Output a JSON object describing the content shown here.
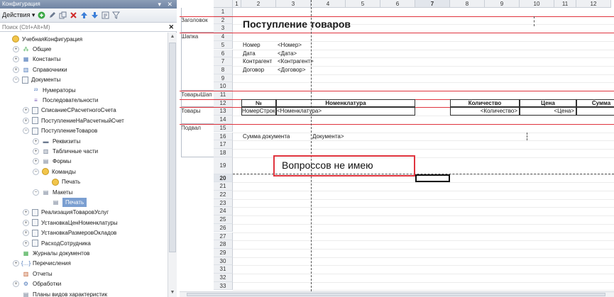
{
  "panel": {
    "title": "Конфигурация",
    "title_buttons": "▾ ✕",
    "actions_label": "Действия ▾",
    "search_placeholder": "Поиск (Ctrl+Alt+M)",
    "search_clear": "✕"
  },
  "tree": [
    {
      "label": "УчебнаяКонфигурация",
      "level": 0,
      "toggle": "",
      "icon": "config-icon"
    },
    {
      "label": "Общие",
      "level": 1,
      "toggle": "+",
      "icon": "common-icon"
    },
    {
      "label": "Константы",
      "level": 1,
      "toggle": "+",
      "icon": "constants-icon"
    },
    {
      "label": "Справочники",
      "level": 1,
      "toggle": "+",
      "icon": "catalogs-icon"
    },
    {
      "label": "Документы",
      "level": 1,
      "toggle": "−",
      "icon": "documents-icon"
    },
    {
      "label": "Нумераторы",
      "level": 2,
      "toggle": "",
      "icon": "numerators-icon"
    },
    {
      "label": "Последовательности",
      "level": 2,
      "toggle": "",
      "icon": "sequences-icon"
    },
    {
      "label": "СписаниеСРасчетногоСчета",
      "level": 2,
      "toggle": "+",
      "icon": "document-icon"
    },
    {
      "label": "ПоступлениеНаРасчетныйСчет",
      "level": 2,
      "toggle": "+",
      "icon": "document-icon"
    },
    {
      "label": "ПоступлениеТоваров",
      "level": 2,
      "toggle": "−",
      "icon": "document-icon"
    },
    {
      "label": "Реквизиты",
      "level": 3,
      "toggle": "+",
      "icon": "attributes-icon"
    },
    {
      "label": "Табличные части",
      "level": 3,
      "toggle": "+",
      "icon": "tabular-sections-icon"
    },
    {
      "label": "Формы",
      "level": 3,
      "toggle": "+",
      "icon": "forms-icon"
    },
    {
      "label": "Команды",
      "level": 3,
      "toggle": "−",
      "icon": "commands-icon"
    },
    {
      "label": "Печать",
      "level": 4,
      "toggle": "",
      "icon": "command-icon"
    },
    {
      "label": "Макеты",
      "level": 3,
      "toggle": "−",
      "icon": "templates-icon"
    },
    {
      "label": "Печать",
      "level": 4,
      "toggle": "",
      "icon": "template-icon",
      "selected": true
    },
    {
      "label": "РеализацияТоваровУслуг",
      "level": 2,
      "toggle": "+",
      "icon": "document-icon"
    },
    {
      "label": "УстановкаЦенНоменклатуры",
      "level": 2,
      "toggle": "+",
      "icon": "document-icon"
    },
    {
      "label": "УстановкаРазмеровОкладов",
      "level": 2,
      "toggle": "+",
      "icon": "document-icon"
    },
    {
      "label": "РасходСотрудника",
      "level": 2,
      "toggle": "+",
      "icon": "document-icon"
    },
    {
      "label": "Журналы документов",
      "level": 1,
      "toggle": "",
      "icon": "journals-icon"
    },
    {
      "label": "Перечисления",
      "level": 1,
      "toggle": "+",
      "icon": "enums-icon"
    },
    {
      "label": "Отчеты",
      "level": 1,
      "toggle": "",
      "icon": "reports-icon"
    },
    {
      "label": "Обработки",
      "level": 1,
      "toggle": "+",
      "icon": "processings-icon"
    },
    {
      "label": "Планы видов характеристик",
      "level": 1,
      "toggle": "",
      "icon": "chart-of-characteristics-icon"
    }
  ],
  "sheet": {
    "columns": [
      "1",
      "2",
      "3",
      "4",
      "5",
      "6",
      "7",
      "8",
      "9",
      "10",
      "11",
      "12"
    ],
    "active_column": "7",
    "rows": [
      "1",
      "2",
      "3",
      "4",
      "5",
      "6",
      "7",
      "8",
      "9",
      "10",
      "11",
      "12",
      "13",
      "14",
      "15",
      "16",
      "17",
      "18",
      "19",
      "20",
      "21",
      "22",
      "23",
      "24",
      "25",
      "26",
      "27",
      "28",
      "29",
      "30",
      "31",
      "32",
      "33"
    ],
    "active_row": "20",
    "sections": [
      {
        "name": "Заголовок",
        "row": "2"
      },
      {
        "name": "Шапка",
        "row": "4"
      },
      {
        "name": "ТоварыШап",
        "row": "11"
      },
      {
        "name": "Товары",
        "row": "13"
      },
      {
        "name": "Подвал",
        "row": "15"
      }
    ],
    "title_text": "Поступление товаров",
    "header_fields": [
      {
        "label": "Номер",
        "param": "<Номер>"
      },
      {
        "label": "Дата",
        "param": "<Дата>"
      },
      {
        "label": "Контрагент",
        "param": "<Контрагент>"
      },
      {
        "label": "Договор",
        "param": "<Договор>"
      }
    ],
    "table_headers": [
      "№",
      "Номенклатура",
      "Количество",
      "Цена",
      "Сумма"
    ],
    "table_params": [
      "НомерСтроки>",
      "<Номенклатура>",
      "<Количество>",
      "<Цена>",
      "<С"
    ],
    "footer_label": "Сумма документа",
    "footer_param": "Документа>",
    "annotation": "Вопроссов не имею",
    "colors": {
      "accent_red": "#e0343e",
      "selection_blue": "#7b9fd1"
    }
  }
}
